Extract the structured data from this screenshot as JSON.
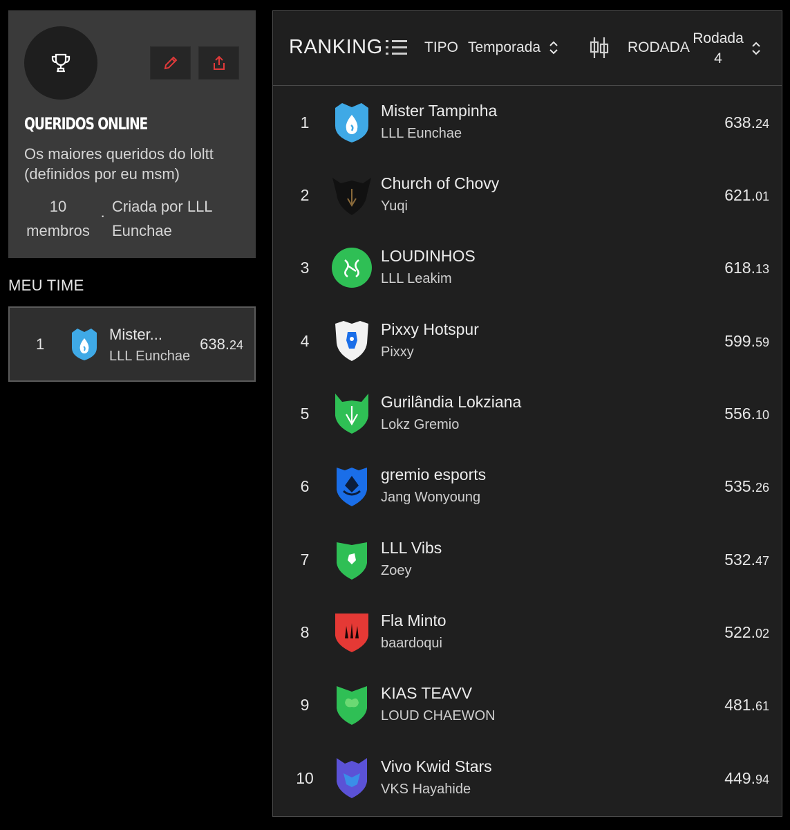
{
  "league": {
    "name": "QUERIDOS ONLINE",
    "description": "Os maiores queridos do loltt (definidos por eu msm)",
    "members_line1": "10",
    "members_line2": "membros",
    "separator": "·",
    "created_by": "Criada por LLL Eunchae"
  },
  "my_team": {
    "section_label": "MEU TIME",
    "position": "1",
    "name": "Mister...",
    "owner": "LLL Eunchae",
    "score_main": "638.",
    "score_decimal": "24"
  },
  "ranking": {
    "title": "RANKING",
    "tipo_label": "TIPO",
    "tipo_value": "Temporada",
    "rodada_label": "RODADA",
    "rodada_value_line1": "Rodada",
    "rodada_value_line2": "4",
    "rows": [
      {
        "position": "1",
        "name": "Mister Tampinha",
        "owner": "LLL Eunchae",
        "score_main": "638.",
        "score_decimal": "24"
      },
      {
        "position": "2",
        "name": "Church of Chovy",
        "owner": "Yuqi",
        "score_main": "621.",
        "score_decimal": "01"
      },
      {
        "position": "3",
        "name": "LOUDINHOS",
        "owner": "LLL Leakim",
        "score_main": "618.",
        "score_decimal": "13"
      },
      {
        "position": "4",
        "name": "Pixxy Hotspur",
        "owner": "Pixxy",
        "score_main": "599.",
        "score_decimal": "59"
      },
      {
        "position": "5",
        "name": "Gurilândia Lokziana",
        "owner": "Lokz Gremio",
        "score_main": "556.",
        "score_decimal": "10"
      },
      {
        "position": "6",
        "name": "gremio esports",
        "owner": "Jang Wonyoung",
        "score_main": "535.",
        "score_decimal": "26"
      },
      {
        "position": "7",
        "name": "LLL Vibs",
        "owner": "Zoey",
        "score_main": "532.",
        "score_decimal": "47"
      },
      {
        "position": "8",
        "name": "Fla Minto",
        "owner": "baardoqui",
        "score_main": "522.",
        "score_decimal": "02"
      },
      {
        "position": "9",
        "name": "KIAS TEAVV",
        "owner": "LOUD CHAEWON",
        "score_main": "481.",
        "score_decimal": "61"
      },
      {
        "position": "10",
        "name": "Vivo Kwid Stars",
        "owner": "VKS Hayahide",
        "score_main": "449.",
        "score_decimal": "94"
      }
    ]
  },
  "colors": {
    "accent_red": "#e03a3a",
    "crest_blue": "#3fa9e6",
    "crest_green": "#2fbf55",
    "crest_darkblue": "#1a6ee8",
    "crest_red": "#e53935",
    "crest_purple": "#5b52d6"
  }
}
